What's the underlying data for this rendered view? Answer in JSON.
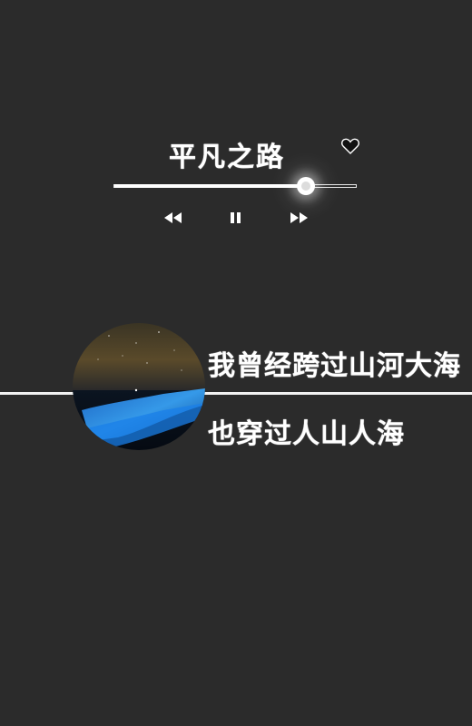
{
  "player": {
    "song_title": "平凡之路",
    "progress": 0.79,
    "icons": {
      "favorite": "heart-icon",
      "rewind": "rewind-icon",
      "pause": "pause-icon",
      "forward": "fast-forward-icon"
    }
  },
  "lyrics": {
    "line1": "我曾经跨过山河大海",
    "line2": "也穿过人山人海"
  },
  "colors": {
    "background": "#2b2b2b",
    "foreground": "#ffffff",
    "glow": "#4fb3ff"
  }
}
